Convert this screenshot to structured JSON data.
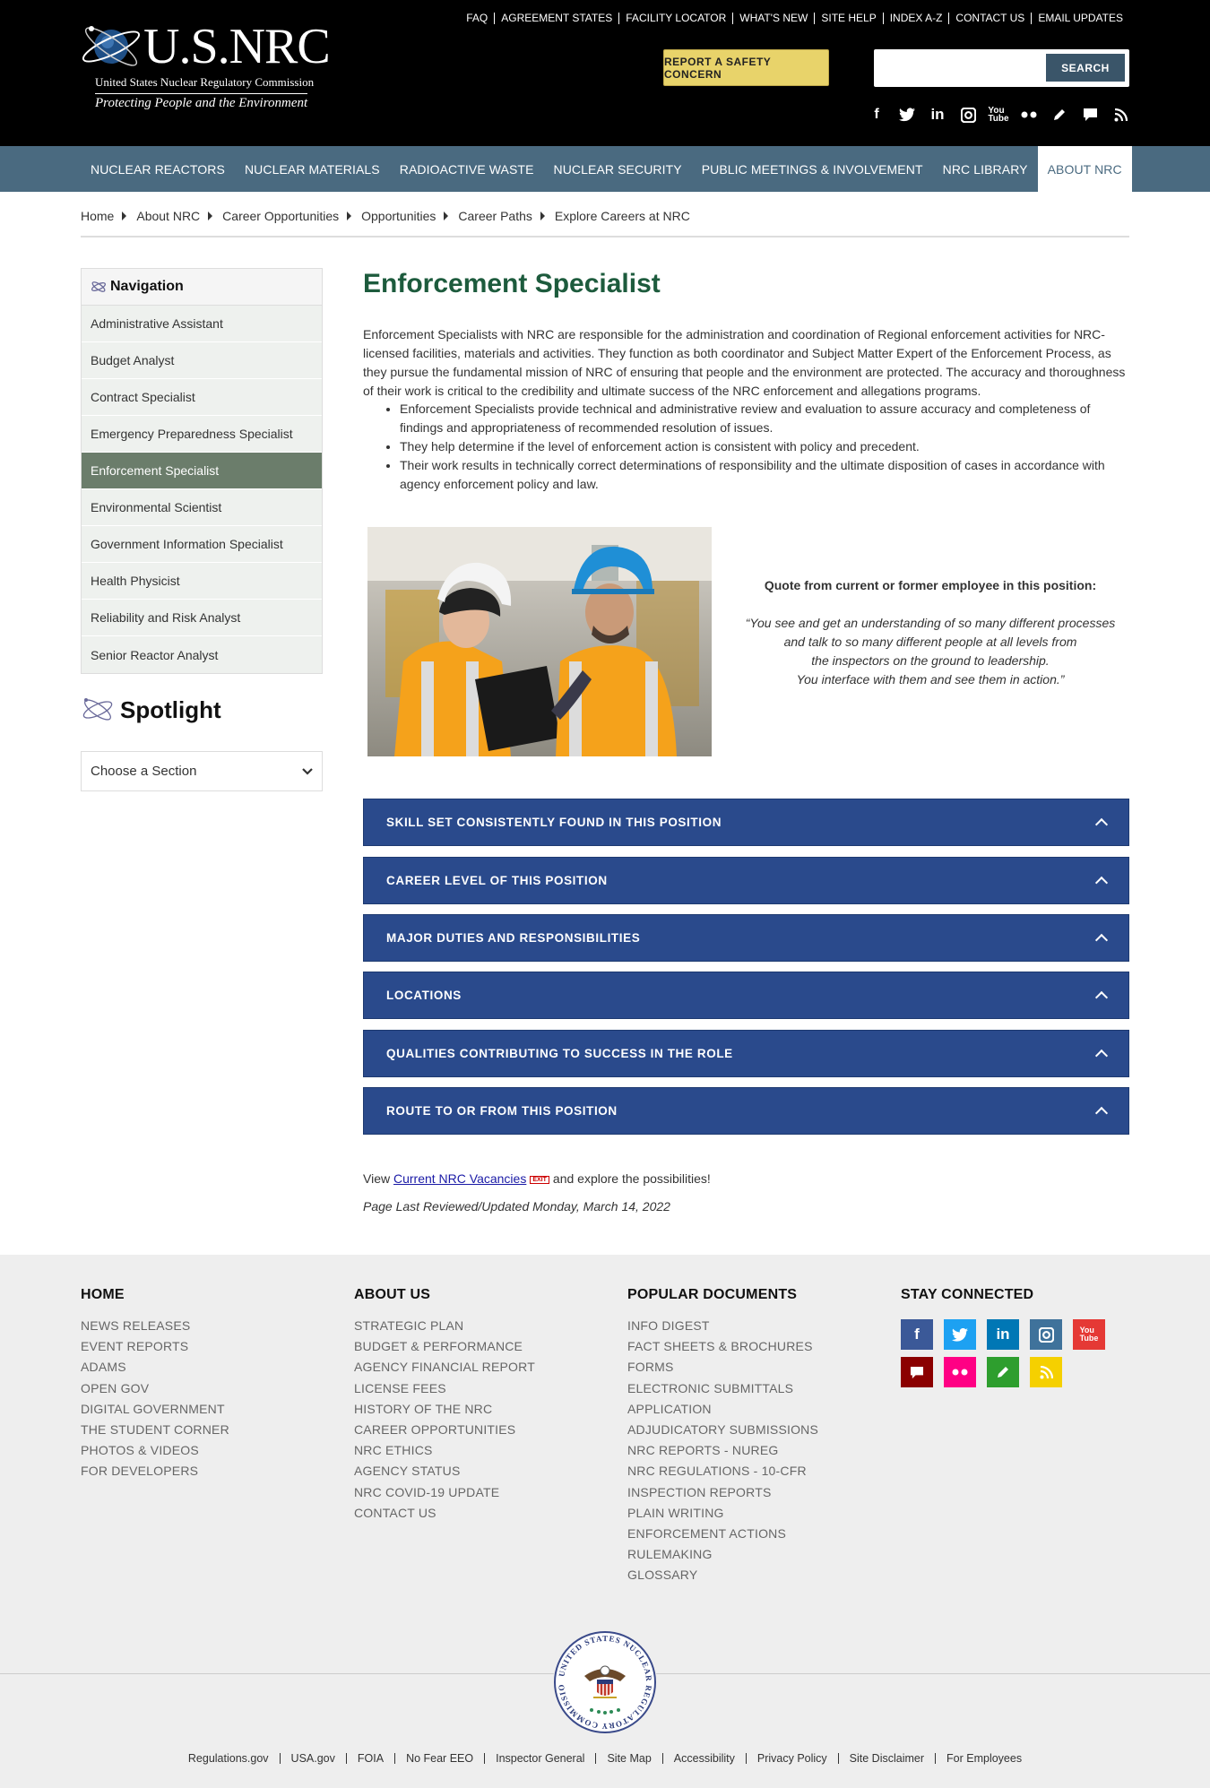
{
  "header": {
    "brand": "U.S.NRC",
    "subtitle": "United States Nuclear Regulatory Commission",
    "tagline": "Protecting People and the Environment",
    "utility_links": [
      "FAQ",
      "AGREEMENT STATES",
      "FACILITY LOCATOR",
      "WHAT'S NEW",
      "SITE HELP",
      "INDEX A-Z",
      "CONTACT US",
      "EMAIL UPDATES"
    ],
    "report_button": "REPORT A SAFETY CONCERN",
    "search_value": "",
    "search_button": "SEARCH"
  },
  "nav": [
    "NUCLEAR REACTORS",
    "NUCLEAR MATERIALS",
    "RADIOACTIVE WASTE",
    "NUCLEAR SECURITY",
    "PUBLIC MEETINGS & INVOLVEMENT",
    "NRC LIBRARY",
    "ABOUT NRC"
  ],
  "nav_active": "ABOUT NRC",
  "breadcrumb": [
    "Home",
    "About NRC",
    "Career Opportunities",
    "Opportunities",
    "Career Paths",
    "Explore Careers at NRC"
  ],
  "sidebar": {
    "heading": "Navigation",
    "items": [
      "Administrative Assistant",
      "Budget Analyst",
      "Contract Specialist",
      "Emergency Preparedness Specialist",
      "Enforcement Specialist",
      "Environmental Scientist",
      "Government Information Specialist",
      "Health Physicist",
      "Reliability and Risk Analyst",
      "Senior Reactor Analyst"
    ],
    "active": "Enforcement Specialist",
    "spotlight": "Spotlight",
    "select_value": "Choose a Section"
  },
  "main": {
    "title": "Enforcement Specialist",
    "intro": "Enforcement Specialists with NRC are responsible for the administration and coordination of Regional enforcement activities for NRC-licensed facilities, materials and activities. They function as both coordinator and Subject Matter Expert of the Enforcement Process, as they pursue the fundamental mission of NRC of ensuring that people and the environment are protected. The accuracy and thoroughness of their work is critical to the credibility and ultimate success of the NRC enforcement and allegations programs.",
    "bullets": [
      "Enforcement Specialists provide technical and administrative review and evaluation to assure accuracy and completeness of findings and appropriateness of recommended resolution of issues.",
      "They help determine if the level of enforcement action is consistent with policy and precedent.",
      "Their work results in technically correct determinations of responsibility and the ultimate disposition of cases in accordance with agency enforcement policy and law."
    ],
    "quote_heading": "Quote from current or former employee in this position:",
    "quote_lines": [
      "“You see and get an understanding of so many different processes",
      "and talk to so many different people at all levels from",
      "the inspectors on the ground to leadership.",
      "You interface with them and see them in action.”"
    ],
    "accordions": [
      "SKILL SET CONSISTENTLY FOUND IN THIS POSITION",
      "CAREER LEVEL OF THIS POSITION",
      "MAJOR DUTIES AND RESPONSIBILITIES",
      "LOCATIONS",
      "QUALITIES CONTRIBUTING TO SUCCESS IN THE ROLE",
      "ROUTE TO OR FROM THIS POSITION"
    ],
    "vacancies_prefix": "View",
    "vacancies_link": "Current NRC Vacancies",
    "exit_badge": "EXIT",
    "vacancies_suffix": "and explore the possibilities!",
    "reviewed": "Page Last Reviewed/Updated Monday, March 14, 2022"
  },
  "footer": {
    "columns": [
      {
        "heading": "HOME",
        "links": [
          "NEWS RELEASES",
          "EVENT REPORTS",
          "ADAMS",
          "OPEN GOV",
          "DIGITAL GOVERNMENT",
          "THE STUDENT CORNER",
          "PHOTOS & VIDEOS",
          "FOR DEVELOPERS"
        ]
      },
      {
        "heading": "ABOUT US",
        "links": [
          "STRATEGIC PLAN",
          "BUDGET & PERFORMANCE",
          "AGENCY FINANCIAL REPORT",
          "LICENSE FEES",
          "HISTORY OF THE NRC",
          "CAREER OPPORTUNITIES",
          "NRC ETHICS",
          "AGENCY STATUS",
          "NRC COVID-19 UPDATE",
          "CONTACT US"
        ]
      },
      {
        "heading": "POPULAR DOCUMENTS",
        "links": [
          "INFO DIGEST",
          "FACT SHEETS & BROCHURES",
          "FORMS",
          "ELECTRONIC SUBMITTALS",
          "APPLICATION",
          "ADJUDICATORY SUBMISSIONS",
          "NRC REPORTS - NUREG",
          "NRC REGULATIONS - 10-CFR",
          "INSPECTION REPORTS",
          "PLAIN WRITING",
          "ENFORCEMENT ACTIONS",
          "RULEMAKING",
          "GLOSSARY"
        ]
      }
    ],
    "stay_connected": "STAY CONNECTED",
    "social_colors": [
      "#3b5998",
      "#1da1f2",
      "#0077b5",
      "#3f729b",
      "#e53935",
      "#8b0000",
      "#ff0084",
      "#2e9e2e",
      "#f5d000"
    ],
    "seal_text": "UNITED STATES NUCLEAR REGULATORY COMMISSION",
    "bottom_links": [
      "Regulations.gov",
      "USA.gov",
      "FOIA",
      "No Fear EEO",
      "Inspector General",
      "Site Map",
      "Accessibility",
      "Privacy Policy",
      "Site Disclaimer",
      "For Employees"
    ]
  }
}
